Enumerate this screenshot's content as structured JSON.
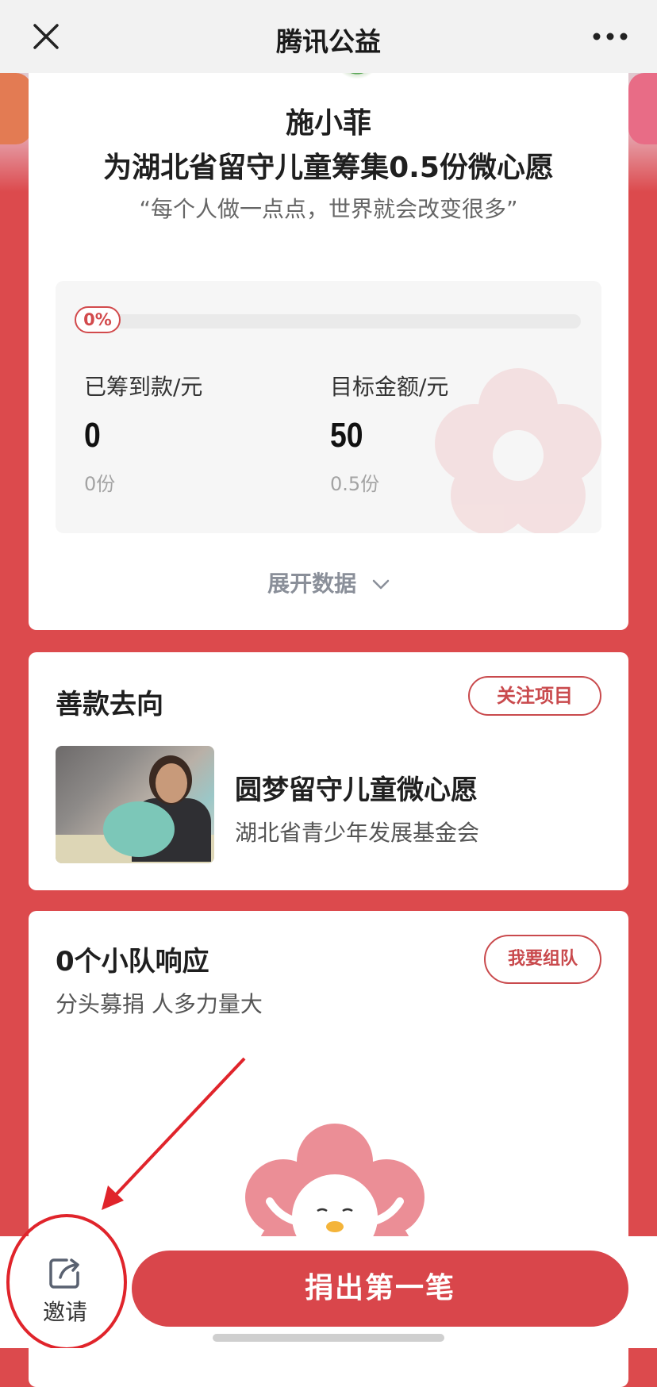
{
  "nav": {
    "title": "腾讯公益"
  },
  "campaign": {
    "person_name": "施小菲",
    "goal_text": "为湖北省留守儿童筹集0.5份微心愿",
    "quote": "“每个人做一点点，世界就会改变很多”"
  },
  "stats": {
    "progress_label": "0%",
    "progress_fraction": 0,
    "raised_label": "已筹到款/元",
    "raised_value": "0",
    "raised_units": "0份",
    "target_label": "目标金额/元",
    "target_value": "50",
    "target_units": "0.5份",
    "expand_label": "展开数据"
  },
  "destination": {
    "title": "善款去向",
    "follow_label": "关注项目",
    "project_name": "圆梦留守儿童微心愿",
    "project_org": "湖北省青少年发展基金会"
  },
  "teams": {
    "title": "0个小队响应",
    "subtitle": "分头募捐 人多力量大",
    "join_label": "我要组队"
  },
  "bottom": {
    "invite_label": "邀请",
    "donate_label": "捐出第一笔"
  },
  "colors": {
    "brand_red": "#d9464b",
    "page_background": "#dc4a4d",
    "annotation_red": "#e0242b"
  },
  "icons": [
    "close-icon",
    "more-icon",
    "chevron-down-icon",
    "share-icon"
  ]
}
